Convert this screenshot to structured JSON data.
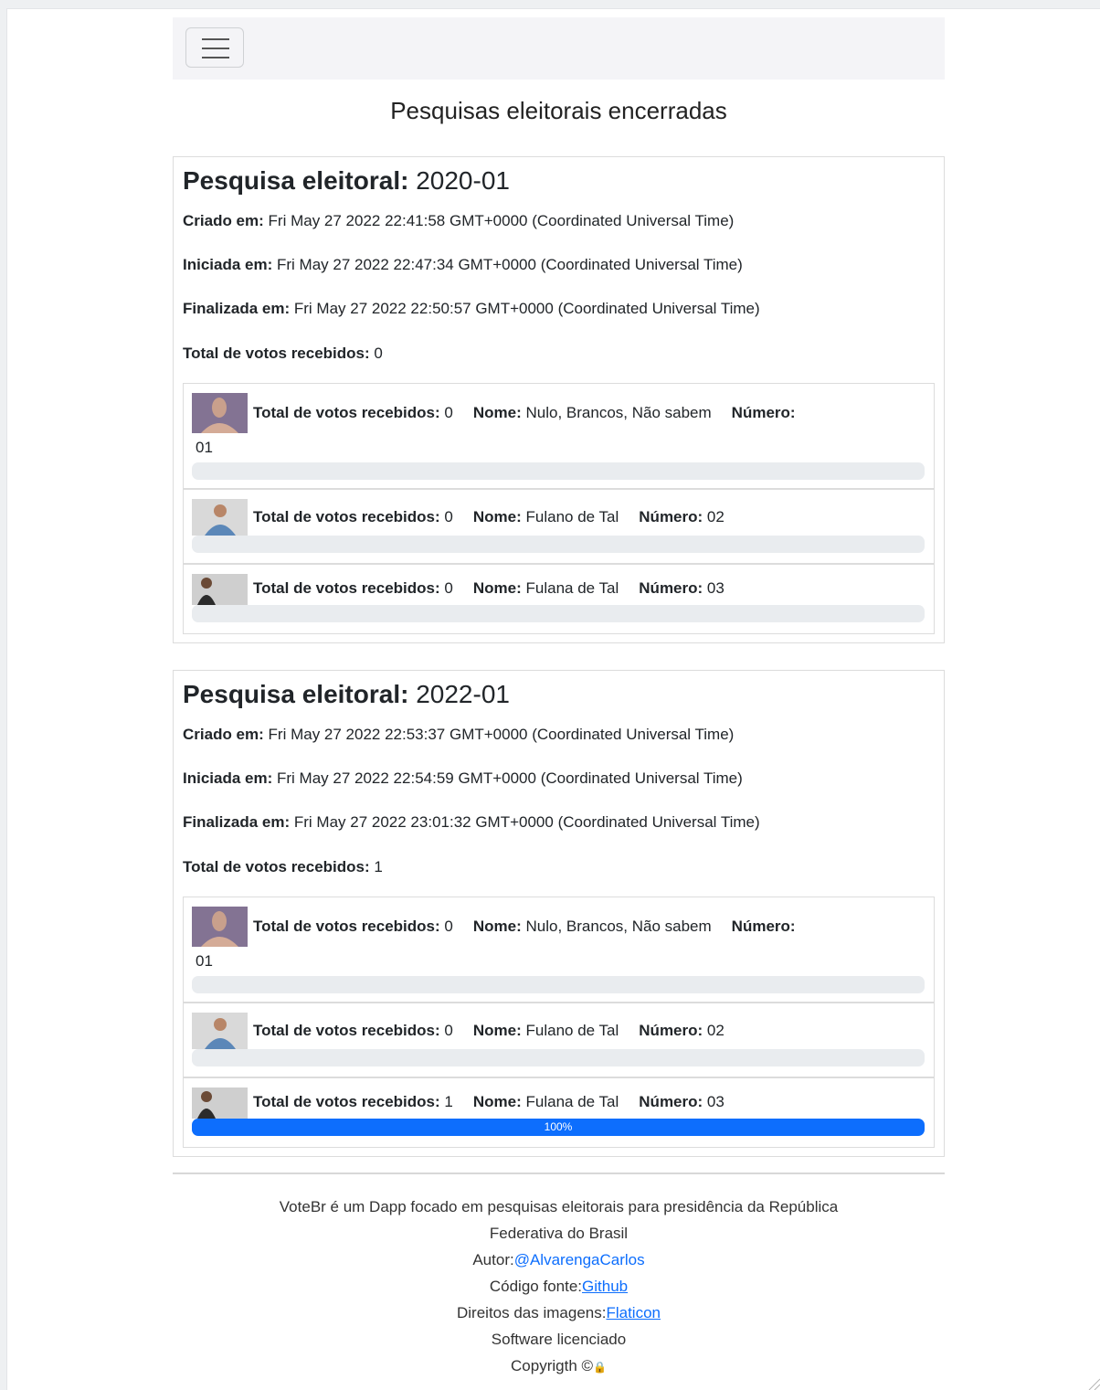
{
  "page": {
    "title": "Pesquisas eleitorais encerradas"
  },
  "labels": {
    "survey": "Pesquisa eleitoral:",
    "created": "Criado em:",
    "started": "Iniciada em:",
    "finished": "Finalizada em:",
    "total_votes": "Total de votos recebidos:",
    "name": "Nome:",
    "number": "Número:"
  },
  "surveys": [
    {
      "id": "2020-01",
      "created": "Fri May 27 2022 22:41:58 GMT+0000 (Coordinated Universal Time)",
      "started": "Fri May 27 2022 22:47:34 GMT+0000 (Coordinated Universal Time)",
      "finished": "Fri May 27 2022 22:50:57 GMT+0000 (Coordinated Universal Time)",
      "total_votes": "0",
      "candidates": [
        {
          "votes": "0",
          "name": "Nulo, Brancos, Não sabem",
          "number": "01",
          "percent": 0
        },
        {
          "votes": "0",
          "name": "Fulano de Tal",
          "number": "02",
          "percent": 0
        },
        {
          "votes": "0",
          "name": "Fulana de Tal",
          "number": "03",
          "percent": 0
        }
      ]
    },
    {
      "id": "2022-01",
      "created": "Fri May 27 2022 22:53:37 GMT+0000 (Coordinated Universal Time)",
      "started": "Fri May 27 2022 22:54:59 GMT+0000 (Coordinated Universal Time)",
      "finished": "Fri May 27 2022 23:01:32 GMT+0000 (Coordinated Universal Time)",
      "total_votes": "1",
      "candidates": [
        {
          "votes": "0",
          "name": "Nulo, Brancos, Não sabem",
          "number": "01",
          "percent": 0
        },
        {
          "votes": "0",
          "name": "Fulano de Tal",
          "number": "02",
          "percent": 0
        },
        {
          "votes": "1",
          "name": "Fulana de Tal",
          "number": "03",
          "percent": 100,
          "percent_label": "100%"
        }
      ]
    }
  ],
  "footer": {
    "line1": "VoteBr é um Dapp focado em pesquisas eleitorais para presidência da República",
    "line2": "Federativa do Brasil",
    "author_label": "Autor:",
    "author_link": "@AlvarengaCarlos",
    "source_label": "Código fonte:",
    "source_link": "Github",
    "images_label": "Direitos das imagens:",
    "images_link": "Flaticon",
    "license": "Software licenciado",
    "copyright": "Copyrigth ©",
    "lock_icon": "🔒"
  },
  "colors": {
    "accent": "#0d6efd",
    "progress_bg": "#e9ecef",
    "navbar_bg": "#f4f4f7"
  },
  "icons": {
    "menu": "hamburger-icon",
    "lock": "lock-icon"
  }
}
